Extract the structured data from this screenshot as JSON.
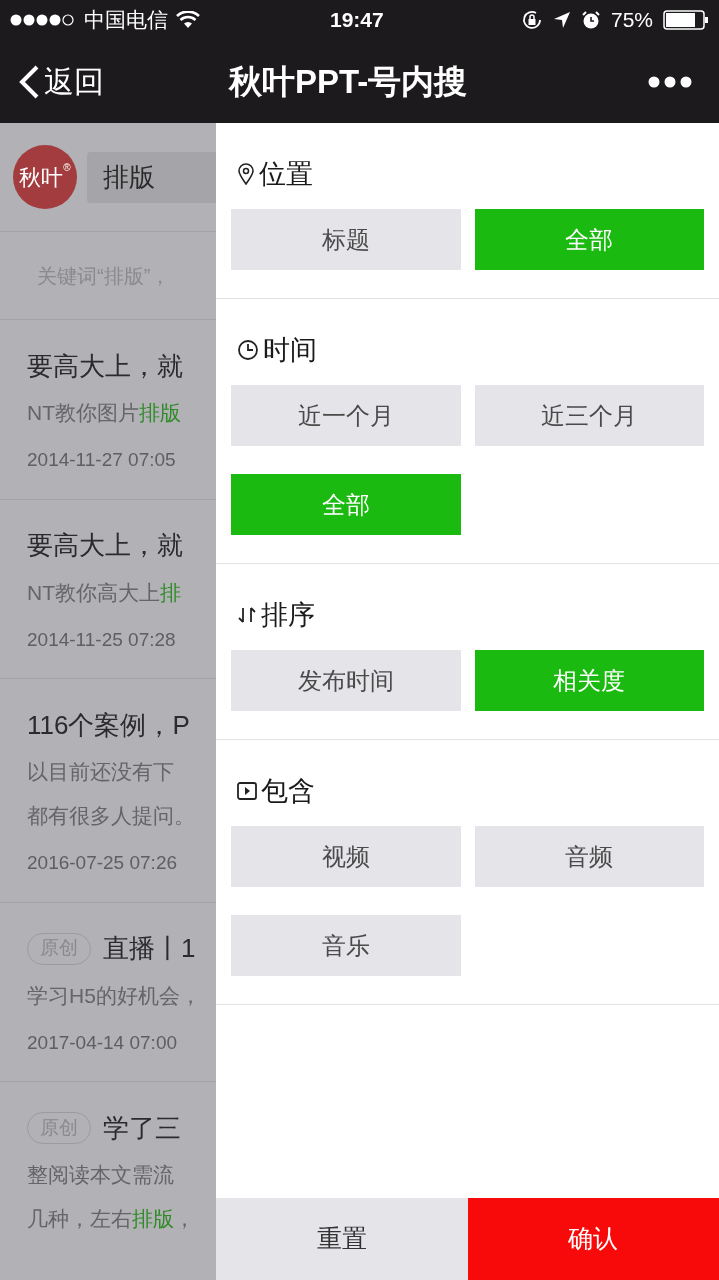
{
  "status_bar": {
    "carrier": "中国电信",
    "time": "19:47",
    "battery": "75%"
  },
  "nav": {
    "back": "返回",
    "title": "秋叶PPT-号内搜"
  },
  "background_page": {
    "logo": "秋叶",
    "logo_mark": "®",
    "search_value": "排版",
    "summary": "关键词“排版”，",
    "results": [
      {
        "title": "要高大上，就",
        "desc_lines": [
          [
            {
              "text": "NT教你图片"
            },
            {
              "text": "排版",
              "highlight": true
            }
          ]
        ],
        "date": "2014-11-27 07:05"
      },
      {
        "title": "要高大上，就",
        "desc_lines": [
          [
            {
              "text": "NT教你高大上"
            },
            {
              "text": "排",
              "highlight": true
            }
          ]
        ],
        "date": "2014-11-25 07:28"
      },
      {
        "title": "116个案例，P",
        "desc_lines": [
          [
            {
              "text": "以目前还没有下"
            }
          ],
          [
            {
              "text": "都有很多人提问。"
            }
          ]
        ],
        "date": "2016-07-25 07:26"
      },
      {
        "badge": "原创",
        "title": "直播丨1",
        "desc_lines": [
          [
            {
              "text": "学习H5的好机会，"
            }
          ]
        ],
        "date": "2017-04-14 07:00"
      },
      {
        "badge": "原创",
        "title": "学了三",
        "desc_lines": [
          [
            {
              "text": "整阅读本文需流"
            }
          ],
          [
            {
              "text": "几种，左右"
            },
            {
              "text": "排版",
              "highlight": true
            },
            {
              "text": "，"
            }
          ]
        ]
      }
    ]
  },
  "filter_panel": {
    "sections": [
      {
        "kind": "pin",
        "title": "位置",
        "options": [
          {
            "label": "标题",
            "selected": false
          },
          {
            "label": "全部",
            "selected": true
          }
        ]
      },
      {
        "kind": "clock",
        "title": "时间",
        "options": [
          {
            "label": "近一个月",
            "selected": false
          },
          {
            "label": "近三个月",
            "selected": false
          },
          {
            "label": "全部",
            "selected": true
          }
        ]
      },
      {
        "kind": "sort",
        "title": "排序",
        "options": [
          {
            "label": "发布时间",
            "selected": false
          },
          {
            "label": "相关度",
            "selected": true
          }
        ]
      },
      {
        "kind": "play",
        "title": "包含",
        "options": [
          {
            "label": "视频",
            "selected": false
          },
          {
            "label": "音频",
            "selected": false
          },
          {
            "label": "音乐",
            "selected": false
          }
        ]
      }
    ],
    "footer": [
      {
        "kind": "reset",
        "label": "重置"
      },
      {
        "kind": "confirm",
        "label": "确认"
      }
    ]
  }
}
